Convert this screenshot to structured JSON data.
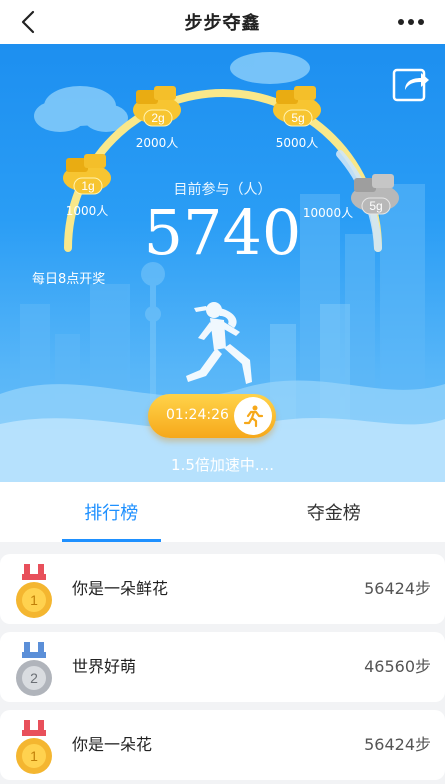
{
  "nav": {
    "title": "步步夺鑫"
  },
  "hero": {
    "participants_label": "目前参与（人）",
    "participants_count": "5740",
    "daily_draw": "每日8点开奖",
    "timer": "01:24:26",
    "speed_text": "1.5倍加速中....",
    "tiers": [
      {
        "coin": "1g",
        "people": "1000人",
        "unlocked": true
      },
      {
        "coin": "2g",
        "people": "2000人",
        "unlocked": true
      },
      {
        "coin": "5g",
        "people": "5000人",
        "unlocked": true
      },
      {
        "coin": "5g",
        "people": "10000人",
        "unlocked": false
      }
    ],
    "colors": {
      "gold": "#f7c531",
      "silver": "#b8b8b8",
      "arc": "#f9e88a"
    }
  },
  "tabs": [
    {
      "label": "排行榜",
      "active": true
    },
    {
      "label": "夺金榜",
      "active": false
    }
  ],
  "ranking": [
    {
      "rank": "1",
      "medal": "gold",
      "name": "你是一朵鲜花",
      "steps": "56424步"
    },
    {
      "rank": "2",
      "medal": "silver",
      "name": "世界好萌",
      "steps": "46560步"
    },
    {
      "rank": "1",
      "medal": "gold",
      "name": "你是一朵花",
      "steps": "56424步"
    }
  ]
}
